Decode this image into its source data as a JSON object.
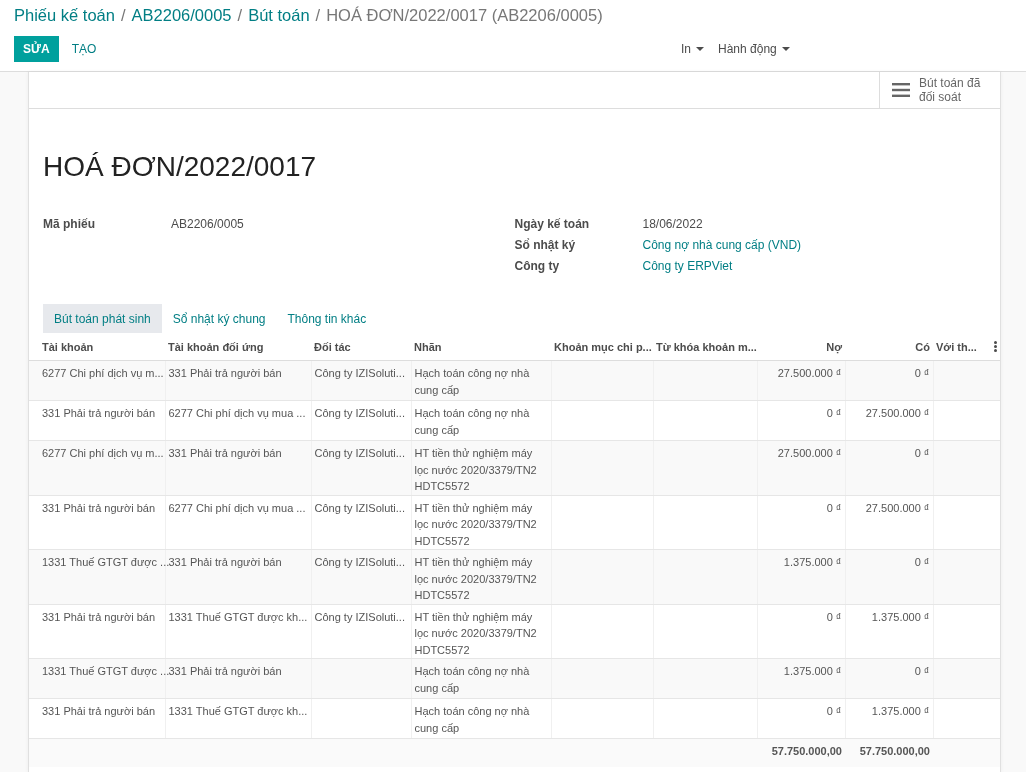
{
  "breadcrumbs": [
    {
      "label": "Phiếu kế toán",
      "link": true
    },
    {
      "separator": "/",
      "label": "AB2206/0005",
      "link": true
    },
    {
      "separator": "/",
      "label": "Bút toán",
      "link": true
    },
    {
      "separator": "/",
      "label": "HOÁ ĐƠN/2022/0017 (AB2206/0005)",
      "link": false
    }
  ],
  "actions": [
    {
      "label": "SỬA",
      "kind": "primary"
    },
    {
      "label": "TẠO",
      "kind": "link"
    }
  ],
  "menus": [
    {
      "label": "In"
    },
    {
      "label": "Hành động"
    }
  ],
  "smart_button": {
    "label": "Bút toán đã đối soát"
  },
  "title": "HOÁ ĐƠN/2022/0017",
  "fields_left": [
    {
      "label": "Mã phiếu",
      "value": "AB2206/0005",
      "link": false
    }
  ],
  "fields_right": [
    {
      "label": "Ngày kế toán",
      "value": "18/06/2022",
      "link": false
    },
    {
      "label": "Sổ nhật ký",
      "value": "Công nợ nhà cung cấp (VND)",
      "link": true
    },
    {
      "label": "Công ty",
      "value": "Công ty ERPViet",
      "link": true
    }
  ],
  "tabs": [
    {
      "label": "Bút toán phát sinh",
      "selected": true
    },
    {
      "label": "Sổ nhật ký chung",
      "selected": false
    },
    {
      "label": "Thông tin khác",
      "selected": false
    }
  ],
  "table": {
    "columns": [
      "Tài khoản",
      "Tài khoản đối ứng",
      "Đối tác",
      "Nhãn",
      "Khoản mục chi p...",
      "Từ khóa khoản m...",
      "Nợ",
      "Có",
      "Với th..."
    ],
    "rows": [
      {
        "account": "6277 Chi phí dịch vụ m...",
        "counter_account": "331 Phải trả người bán",
        "partner": "Công ty IZISoluti...",
        "label": "Hạch toán công nợ nhà cung cấp",
        "debit": "27.500.000 ₫",
        "credit": "0 ₫"
      },
      {
        "account": "331 Phải trả người bán",
        "counter_account": "6277 Chi phí dịch vụ mua ...",
        "partner": "Công ty IZISoluti...",
        "label": "Hạch toán công nợ nhà cung cấp",
        "debit": "0 ₫",
        "credit": "27.500.000 ₫"
      },
      {
        "account": "6277 Chi phí dịch vụ m...",
        "counter_account": "331 Phải trả người bán",
        "partner": "Công ty IZISoluti...",
        "label": "HT tiền thử nghiệm máy lọc nước 2020/3379/TN2 HDTC5572",
        "debit": "27.500.000 ₫",
        "credit": "0 ₫"
      },
      {
        "account": "331 Phải trả người bán",
        "counter_account": "6277 Chi phí dịch vụ mua ...",
        "partner": "Công ty IZISoluti...",
        "label": "HT tiền thử nghiệm máy lọc nước 2020/3379/TN2 HDTC5572",
        "debit": "0 ₫",
        "credit": "27.500.000 ₫"
      },
      {
        "account": "1331 Thuế GTGT được ...",
        "counter_account": "331 Phải trả người bán",
        "partner": "Công ty IZISoluti...",
        "label": "HT tiền thử nghiệm máy lọc nước 2020/3379/TN2 HDTC5572",
        "debit": "1.375.000 ₫",
        "credit": "0 ₫"
      },
      {
        "account": "331 Phải trả người bán",
        "counter_account": "1331 Thuế GTGT được kh...",
        "partner": "Công ty IZISoluti...",
        "label": "HT tiền thử nghiệm máy lọc nước 2020/3379/TN2 HDTC5572",
        "debit": "0 ₫",
        "credit": "1.375.000 ₫"
      },
      {
        "account": "1331 Thuế GTGT được ...",
        "counter_account": "331 Phải trả người bán",
        "label": "Hạch toán công nợ nhà cung cấp",
        "debit": "1.375.000 ₫",
        "credit": "0 ₫"
      },
      {
        "account": "331 Phải trả người bán",
        "counter_account": "1331 Thuế GTGT được kh...",
        "label": "Hạch toán công nợ nhà cung cấp",
        "debit": "0 ₫",
        "credit": "1.375.000 ₫"
      }
    ],
    "totals": {
      "debit": "57.750.000,00",
      "credit": "57.750.000,00"
    }
  }
}
